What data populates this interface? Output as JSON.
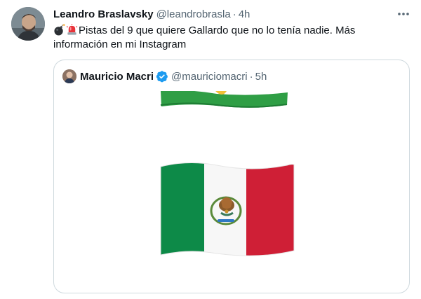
{
  "tweet": {
    "author": {
      "display_name": "Leandro Braslavsky",
      "handle": "@leandrobrasla",
      "time": "4h"
    },
    "separator": "·",
    "emojis": [
      "bomb-emoji",
      "police-light-emoji"
    ],
    "text": "Pistas del 9 que quiere Gallardo que no lo tenía nadie. Más información en mi Instagram",
    "more_icon": "more-horizontal-icon"
  },
  "quoted_tweet": {
    "author": {
      "display_name": "Mauricio Macri",
      "handle": "@mauriciomacri",
      "time": "5h",
      "verified": true
    },
    "separator": "·",
    "media": [
      "brazil-flag-emoji",
      "mexico-flag-emoji"
    ]
  },
  "colors": {
    "text_primary": "#0f1419",
    "text_secondary": "#536471",
    "border": "#cfd9de",
    "verified": "#1d9bf0"
  }
}
